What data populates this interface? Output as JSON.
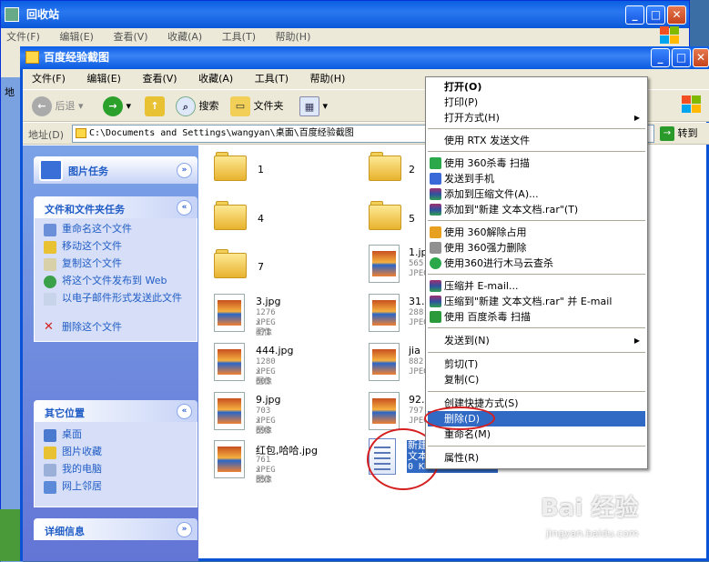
{
  "background_window": {
    "title": "回收站",
    "menu": [
      "文件(F)",
      "编辑(E)",
      "查看(V)",
      "收藏(A)",
      "工具(T)",
      "帮助(H)"
    ],
    "side_label": "地"
  },
  "window": {
    "title": "百度经验截图",
    "menu": [
      "文件(F)",
      "编辑(E)",
      "查看(V)",
      "收藏(A)",
      "工具(T)",
      "帮助(H)"
    ],
    "toolbar": {
      "back": "后退",
      "search": "搜索",
      "folders": "文件夹"
    },
    "address": {
      "label": "地址(D)",
      "path": "C:\\Documents and Settings\\wangyan\\桌面\\百度经验截图",
      "go": "转到"
    }
  },
  "task_pane": {
    "picture_tasks": "图片任务",
    "file_tasks": {
      "title": "文件和文件夹任务",
      "items": [
        "重命名这个文件",
        "移动这个文件",
        "复制这个文件",
        "将这个文件发布到 Web",
        "以电子邮件形式发送此文件",
        "删除这个文件"
      ]
    },
    "other_places": {
      "title": "其它位置",
      "items": [
        "桌面",
        "图片收藏",
        "我的电脑",
        "网上邻居"
      ]
    },
    "details": "详细信息"
  },
  "files": {
    "folder1": "1",
    "folder2": "2",
    "folder4": "4",
    "folder5": "5",
    "folder7": "7",
    "f1": {
      "name": "1.jpg",
      "dims": "565",
      "type": "JPEG"
    },
    "f3": {
      "name": "3.jpg",
      "dims": "1276 x 471",
      "type": "JPEG 图像"
    },
    "f31": {
      "name": "31.",
      "dims": "288",
      "type": "JPEG"
    },
    "f444": {
      "name": "444.jpg",
      "dims": "1280 x 605",
      "type": "JPEG 图像"
    },
    "fjia": {
      "name": "jia",
      "dims": "882",
      "type": "JPEG"
    },
    "f9": {
      "name": "9.jpg",
      "dims": "703 x 698",
      "type": "JPEG 图像"
    },
    "f92": {
      "name": "92.",
      "dims": "797",
      "type": "JPEG"
    },
    "fhb": {
      "name": "红包,哈哈.jpg",
      "dims": "761 x 853",
      "type": "JPEG 图像"
    },
    "ftxt": {
      "name1": "新建",
      "name2": "文本",
      "size": "0 KB"
    }
  },
  "context_menu": {
    "open": "打开(O)",
    "print": "打印(P)",
    "open_with": "打开方式(H)",
    "rtx": "使用 RTX 发送文件",
    "scan360": "使用 360杀毒 扫描",
    "send_phone": "发送到手机",
    "add_archive": "添加到压缩文件(A)...",
    "add_rar": "添加到\"新建 文本文档.rar\"(T)",
    "unlock360": "使用 360解除占用",
    "force_del360": "使用 360强力删除",
    "trojan360": "使用360进行木马云查杀",
    "zip_email": "压缩并 E-mail...",
    "zip_rar_email": "压缩到\"新建 文本文档.rar\" 并 E-mail",
    "baidu_scan": "使用 百度杀毒 扫描",
    "send_to": "发送到(N)",
    "cut": "剪切(T)",
    "copy": "复制(C)",
    "shortcut": "创建快捷方式(S)",
    "delete": "删除(D)",
    "rename": "重命名(M)",
    "properties": "属性(R)"
  },
  "watermark": {
    "brand": "Bai 经验",
    "url": "jingyan.baidu.com"
  },
  "colors": {
    "selection": "#316ac5",
    "title_blue": "#0a5ae0",
    "highlight_oval": "#d42020"
  }
}
